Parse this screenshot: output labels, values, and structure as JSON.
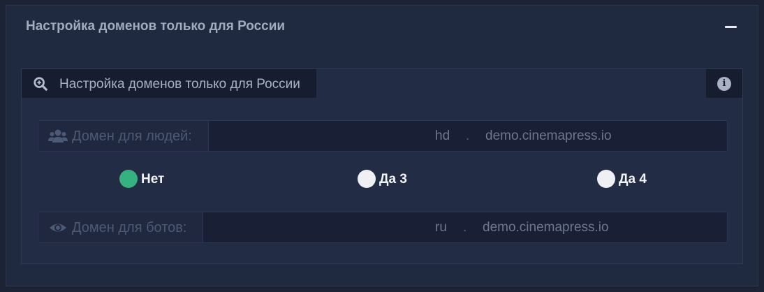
{
  "panel": {
    "title": "Настройка доменов только для России",
    "collapse_icon": "minus-icon"
  },
  "card": {
    "tab_label": "Настройка доменов только для России",
    "tab_icon": "search-plus-icon",
    "info_icon": "info-circle-icon",
    "info_glyph": "i"
  },
  "human_domain": {
    "label": "Домен для людей:",
    "icon": "users-icon",
    "subdomain": "hd",
    "separator": ".",
    "domain": "demo.cinemapress.io"
  },
  "options": [
    {
      "label": "Нет",
      "checked": true
    },
    {
      "label": "Да 3",
      "checked": false
    },
    {
      "label": "Да 4",
      "checked": false
    }
  ],
  "bot_domain": {
    "label": "Домен для ботов:",
    "icon": "eye-icon",
    "subdomain": "ru",
    "separator": ".",
    "domain": "demo.cinemapress.io"
  },
  "colors": {
    "checked": "#35b27f",
    "unchecked": "#eef0f4",
    "background": "#1f2940"
  }
}
